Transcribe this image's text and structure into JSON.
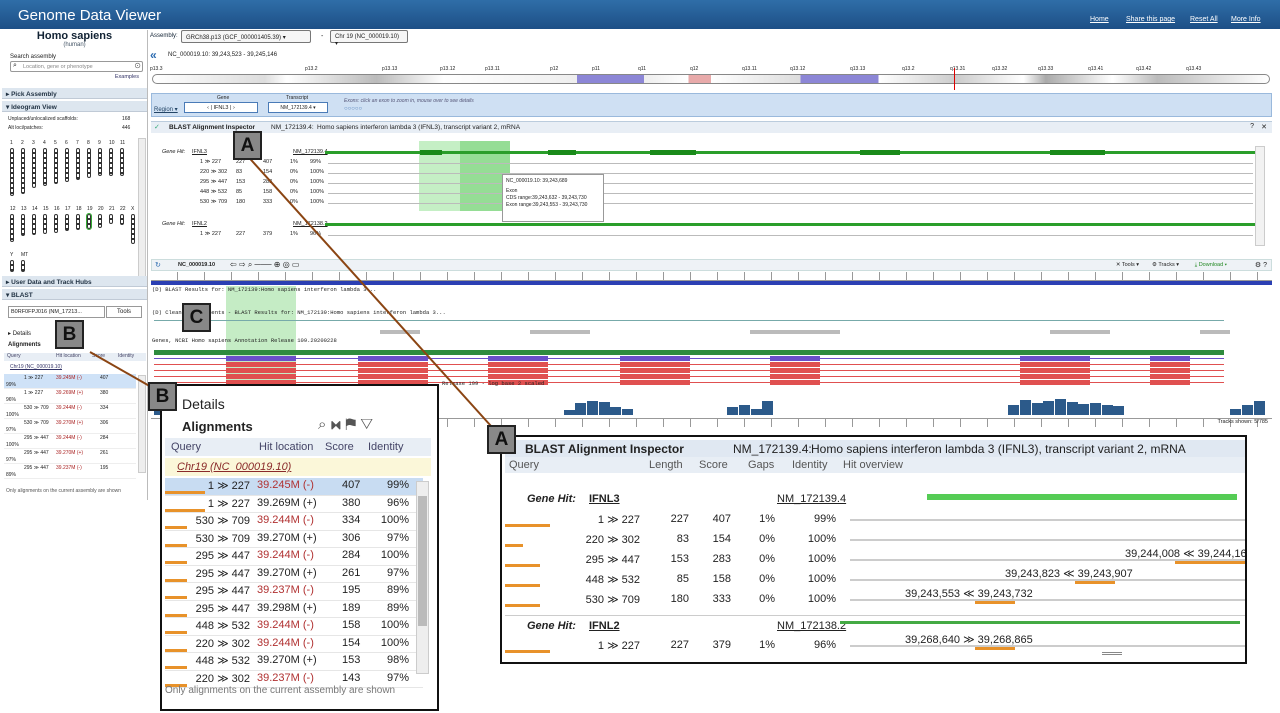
{
  "app": {
    "title": "Genome Data Viewer",
    "links": [
      "Home",
      "Share this page",
      "Reset All",
      "More Info"
    ]
  },
  "organism": {
    "name": "Homo sapiens",
    "common": "(human)"
  },
  "assembly": {
    "label": "Assembly:",
    "value": "GRCh38.p13 (GCF_000001405.39)",
    "chr": "Chr 19 (NC_000019.10)"
  },
  "search": {
    "label": "Search assembly",
    "placeholder": "Location, gene or phenotype",
    "examples": "Examples"
  },
  "sections": {
    "pick": "Pick Assembly",
    "ideogram": "Ideogram View",
    "unplaced": "Unplaced/unlocalized scaffolds:",
    "unplaced_n": "168",
    "altloci": "Alt loci/patches:",
    "altloci_n": "446",
    "userdata": "User Data and Track Hubs",
    "blast": "BLAST"
  },
  "blast_side": {
    "job": "B0RF0FPJ016 (NM_17213...",
    "tools": "Tools",
    "details": "Details",
    "alignments": "Alignments",
    "footer": "Only alignments on the current assembly are shown"
  },
  "chromosomes": [
    "1",
    "2",
    "3",
    "4",
    "5",
    "6",
    "7",
    "8",
    "9",
    "10",
    "11",
    "12",
    "13",
    "14",
    "15",
    "16",
    "17",
    "18",
    "19",
    "20",
    "21",
    "22",
    "X",
    "Y",
    "MT"
  ],
  "location": "NC_000019.10: 39,243,523 - 39,245,146",
  "bands": [
    "p13.3",
    "p13.2",
    "p13.13",
    "p13.12",
    "p13.11",
    "p12",
    "p11",
    "q11",
    "q12",
    "q13.11",
    "q13.12",
    "q13.13",
    "q13.2",
    "q13.31",
    "q13.32",
    "q13.33",
    "q13.41",
    "q13.42",
    "q13.43"
  ],
  "region": {
    "label": "Region",
    "gene_label": "Gene",
    "gene": "IFNL3",
    "transcript_label": "Transcript",
    "transcript": "NM_172139.4",
    "exons_hint": "Exons: click an exon to zoom in, mouse over to see details"
  },
  "inspector": {
    "title": "BLAST Alignment Inspector",
    "accession": "NM_172139.4:",
    "desc": "Homo sapiens interferon lambda 3 (IFNL3), transcript variant 2, mRNA"
  },
  "tooltip": {
    "loc": "NC_000019.10: 39,243,689",
    "exon": "Exon",
    "cds": "CDS range:39,243,632 - 39,243,730",
    "exonr": "Exon range:39,243,553 - 39,243,730"
  },
  "viewer": {
    "acc": "NC_000019.10",
    "tools": "Tools",
    "tracks": "Tracks",
    "download": "Download",
    "shown": "Tracks shown: 5/785",
    "t1": "(D) BLAST Results for: NM_172139:Homo sapiens interferon lambda 3...",
    "t2": "(D) Cleaned Alignments - BLAST Results for: NM_172139:Homo sapiens interferon lambda 3...",
    "t3": "Genes, NCBI Homo sapiens Annotation Release 109.20200228",
    "t4": "Release 109 - log base 2 scaled"
  },
  "boxB": {
    "title": "Details",
    "tab": "Alignments",
    "cols": [
      "Query",
      "Hit location",
      "Score",
      "Identity"
    ],
    "group": "Chr19 (NC_000019.10)",
    "rows": [
      {
        "q": "1 ≫ 227",
        "loc": "39.245M (-)",
        "score": "407",
        "id": "99%"
      },
      {
        "q": "1 ≫ 227",
        "loc": "39.269M (+)",
        "score": "380",
        "id": "96%"
      },
      {
        "q": "530 ≫ 709",
        "loc": "39.244M (-)",
        "score": "334",
        "id": "100%"
      },
      {
        "q": "530 ≫ 709",
        "loc": "39.270M (+)",
        "score": "306",
        "id": "97%"
      },
      {
        "q": "295 ≫ 447",
        "loc": "39.244M (-)",
        "score": "284",
        "id": "100%"
      },
      {
        "q": "295 ≫ 447",
        "loc": "39.270M (+)",
        "score": "261",
        "id": "97%"
      },
      {
        "q": "295 ≫ 447",
        "loc": "39.237M (-)",
        "score": "195",
        "id": "89%"
      },
      {
        "q": "295 ≫ 447",
        "loc": "39.298M (+)",
        "score": "189",
        "id": "89%"
      },
      {
        "q": "448 ≫ 532",
        "loc": "39.244M (-)",
        "score": "158",
        "id": "100%"
      },
      {
        "q": "220 ≫ 302",
        "loc": "39.244M (-)",
        "score": "154",
        "id": "100%"
      },
      {
        "q": "448 ≫ 532",
        "loc": "39.270M (+)",
        "score": "153",
        "id": "98%"
      },
      {
        "q": "220 ≫ 302",
        "loc": "39.237M (-)",
        "score": "143",
        "id": "97%"
      }
    ],
    "footer": "Only alignments on the current assembly are shown"
  },
  "boxA": {
    "title": "BLAST Alignment Inspector",
    "accession": "NM_172139.4:",
    "desc": "Homo sapiens interferon lambda 3 (IFNL3), transcript variant 2, mRNA",
    "cols": [
      "Query",
      "Length",
      "Score",
      "Gaps",
      "Identity",
      "Hit overview"
    ],
    "g1": {
      "label": "Gene Hit:",
      "gene": "IFNL3",
      "acc": "NM_172139.4"
    },
    "g1rows": [
      {
        "q": "1 ≫ 227",
        "len": "227",
        "score": "407",
        "gaps": "1%",
        "id": "99%",
        "range": ""
      },
      {
        "q": "220 ≫ 302",
        "len": "83",
        "score": "154",
        "gaps": "0%",
        "id": "100%",
        "range": ""
      },
      {
        "q": "295 ≫ 447",
        "len": "153",
        "score": "283",
        "gaps": "0%",
        "id": "100%",
        "range": "39,244,008 ≪ 39,244,160"
      },
      {
        "q": "448 ≫ 532",
        "len": "85",
        "score": "158",
        "gaps": "0%",
        "id": "100%",
        "range": "39,243,823 ≪ 39,243,907"
      },
      {
        "q": "530 ≫ 709",
        "len": "180",
        "score": "333",
        "gaps": "0%",
        "id": "100%",
        "range": "39,243,553 ≪ 39,243,732"
      }
    ],
    "g2": {
      "label": "Gene Hit:",
      "gene": "IFNL2",
      "acc": "NM_172138.2"
    },
    "g2rows": [
      {
        "q": "1 ≫ 227",
        "len": "227",
        "score": "379",
        "gaps": "1%",
        "id": "96%",
        "range": "39,268,640 ≫ 39,268,865"
      }
    ]
  },
  "labels": {
    "a": "A",
    "b": "B",
    "c": "C"
  }
}
